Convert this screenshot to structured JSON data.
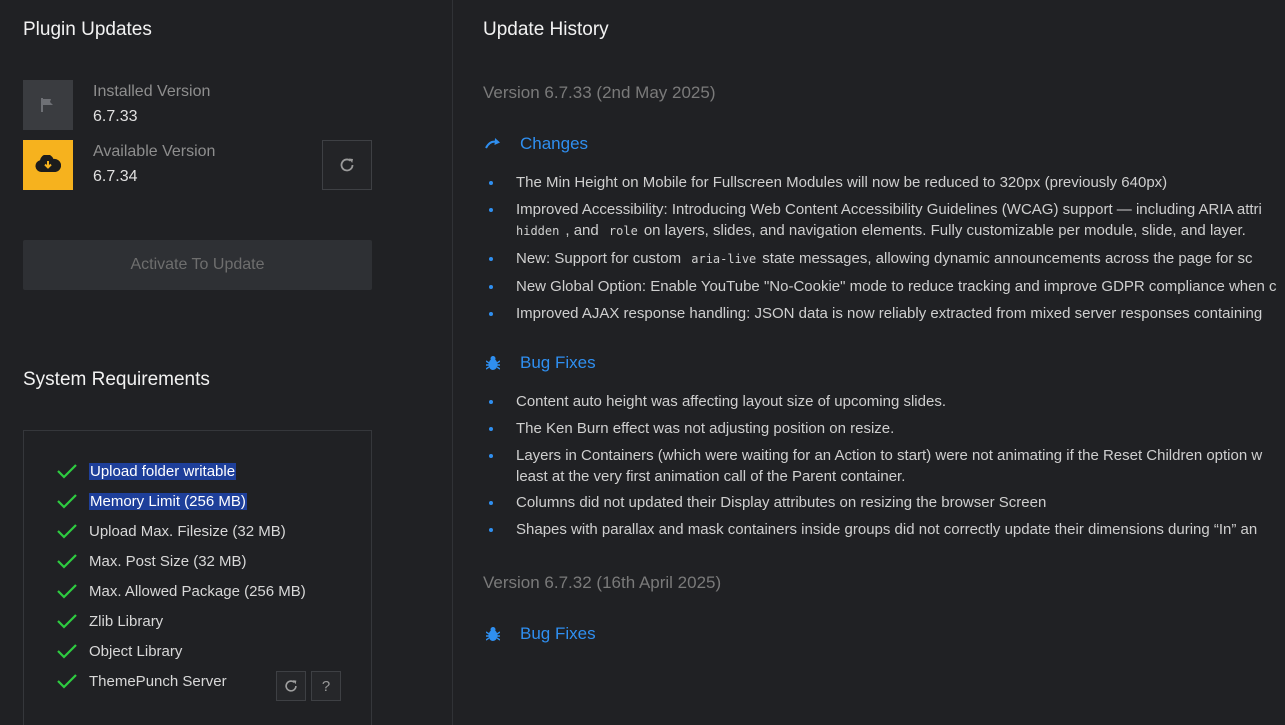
{
  "plugin_updates": {
    "title": "Plugin Updates",
    "installed_label": "Installed Version",
    "installed_value": "6.7.33",
    "available_label": "Available Version",
    "available_value": "6.7.34",
    "activate_button": "Activate To Update"
  },
  "system_requirements": {
    "title": "System Requirements",
    "items": [
      {
        "label": "Upload folder writable",
        "selected": true
      },
      {
        "label": "Memory Limit (256 MB)",
        "selected": true
      },
      {
        "label": "Upload Max. Filesize (32 MB)"
      },
      {
        "label": "Max. Post Size (32 MB)"
      },
      {
        "label": "Max. Allowed Package (256 MB)"
      },
      {
        "label": "Zlib Library"
      },
      {
        "label": "Object Library"
      },
      {
        "label": "ThemePunch Server"
      }
    ],
    "help_button": "?"
  },
  "update_history": {
    "title": "Update History",
    "versions": [
      {
        "title": "Version 6.7.33 (2nd May 2025)",
        "changes_heading": "Changes",
        "changes": [
          "The Min Height on Mobile for Fullscreen Modules will now be reduced to 320px (previously 640px)",
          "Improved Accessibility: Introducing Web Content Accessibility Guidelines (WCAG) support — including ARIA attri",
          "hidden",
          ", and",
          "role",
          "on layers, slides, and navigation elements. Fully customizable per module, slide, and layer.",
          "New: Support for custom",
          "aria-live",
          "state messages, allowing dynamic announcements across the page for sc",
          "New Global Option: Enable YouTube \"No-Cookie\" mode to reduce tracking and improve GDPR compliance when c",
          "Improved AJAX response handling: JSON data is now reliably extracted from mixed server responses containing"
        ],
        "bugfix_heading": "Bug Fixes",
        "bugfixes": [
          "Content auto height was affecting layout size of upcoming slides.",
          "The Ken Burn effect was not adjusting position on resize.",
          "Layers in Containers (which were waiting for an Action to start) were not animating if the Reset Children option w",
          "least at the very first animation call of the Parent container.",
          "Columns did not updated their Display attributes on resizing the browser Screen",
          "Shapes with parallax and mask containers inside groups did not correctly update their dimensions during “In” an"
        ]
      },
      {
        "title": "Version 6.7.32 (16th April 2025)",
        "bugfix_heading": "Bug Fixes"
      }
    ]
  },
  "colors": {
    "background": "#202124",
    "accent_blue": "#2f8ff0",
    "accent_yellow": "#f6b21e",
    "check_green": "#2ecc40",
    "selection": "#1e3f9a"
  },
  "icons": {
    "installed": "flag-icon",
    "available": "download-cloud-icon",
    "refresh": "refresh-icon",
    "check": "check-icon",
    "changes": "redo-arrow-icon",
    "bugfix": "bug-icon"
  }
}
